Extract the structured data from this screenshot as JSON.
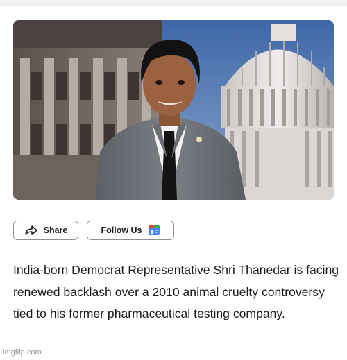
{
  "article": {
    "share_label": "Share",
    "follow_label": "Follow Us",
    "follow_badge_icon": "google-news-icon",
    "share_icon": "share-arrow-icon",
    "headline": "India-born Democrat Representative Shri Thanedar is facing renewed backlash over a 2010 animal cruelty controversy tied to his former pharmaceutical testing company."
  },
  "watermark": "imgflip.com",
  "colors": {
    "border": "#8f8f8f",
    "text": "#1a1a1a",
    "watermark": "#9a9a9a",
    "sky": "#5d7ea6"
  }
}
